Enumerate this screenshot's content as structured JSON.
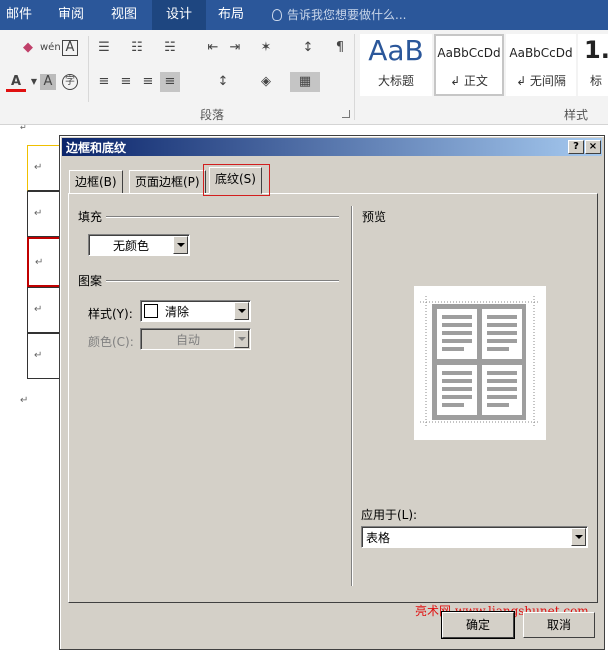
{
  "menu": {
    "items": [
      {
        "label": "邮件"
      },
      {
        "label": "审阅"
      },
      {
        "label": "视图"
      },
      {
        "label": "设计"
      },
      {
        "label": "布局"
      }
    ],
    "tell_me": "告诉我您想要做什么..."
  },
  "ribbon": {
    "paragraph_group_label": "段落",
    "styles_group_label": "样式",
    "styles": [
      {
        "preview": "AaB",
        "name": "大标题"
      },
      {
        "preview": "AaBbCcDd",
        "name": "↲ 正文"
      },
      {
        "preview": "AaBbCcDd",
        "name": "↲ 无间隔"
      },
      {
        "preview": "1.",
        "name": "标"
      }
    ],
    "icons": [
      "eraser-icon",
      "phonetic-guide-icon",
      "char-border-icon",
      "bullets-icon",
      "numbering-icon",
      "multilevel-list-icon",
      "decrease-indent-icon",
      "increase-indent-icon",
      "text-effects-icon",
      "sort-icon",
      "show-marks-icon",
      "font-color-icon",
      "char-shading-icon",
      "enclose-char-icon",
      "align-left-icon",
      "center-icon",
      "align-right-icon",
      "justify-icon",
      "line-spacing-icon",
      "shading-icon",
      "borders-icon"
    ],
    "colors": {
      "font_color_bar": "#e01010",
      "menubar": "#2b579a"
    }
  },
  "doc": {
    "para_mark": "↵"
  },
  "dialog": {
    "title": "边框和底纹",
    "help": "?",
    "close": "×",
    "tabs": [
      {
        "label": "边框(B)"
      },
      {
        "label": "页面边框(P)"
      },
      {
        "label": "底纹(S)"
      }
    ],
    "fill": {
      "label": "填充",
      "value": "无颜色"
    },
    "pattern": {
      "label": "图案",
      "style_label": "样式(Y):",
      "style_value": "清除",
      "color_label": "颜色(C):",
      "color_value": "自动"
    },
    "preview": {
      "label": "预览"
    },
    "apply_to": {
      "label": "应用于(L):",
      "value": "表格"
    },
    "ok": "确定",
    "cancel": "取消",
    "watermark": "亮术网 www.liangshunet.com"
  }
}
